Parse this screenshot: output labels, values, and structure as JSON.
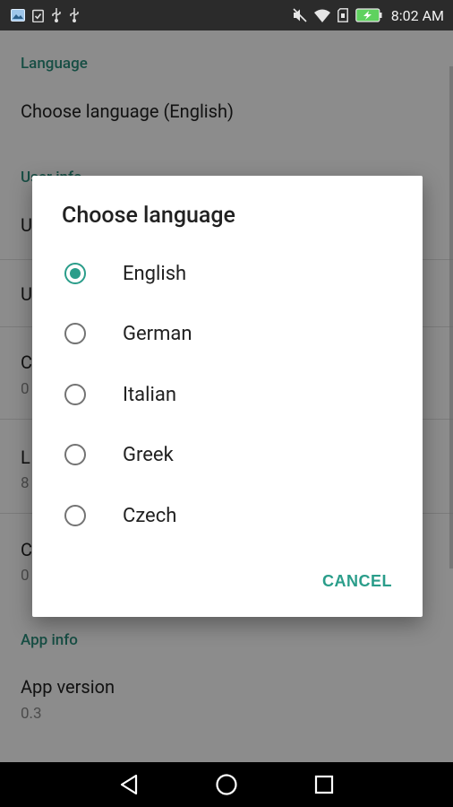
{
  "status_bar": {
    "time": "8:02 AM",
    "left_icons": [
      "image-icon",
      "clipboard-check-icon",
      "usb-icon",
      "usb-icon"
    ],
    "right_icons": [
      "mute-icon",
      "wifi-icon",
      "sim-icon",
      "battery-charging-icon"
    ]
  },
  "settings": {
    "language_header": "Language",
    "choose_language_title": "Choose language (English)",
    "user_info_header": "User info",
    "rows": [
      {
        "title": "U",
        "summary": ""
      },
      {
        "title": "U",
        "summary": ""
      },
      {
        "title": "C",
        "summary": "0"
      },
      {
        "title": "L",
        "summary": "8"
      },
      {
        "title": "C",
        "summary": "0"
      }
    ],
    "app_info_header": "App info",
    "app_version_title": "App version",
    "app_version_value": "0.3"
  },
  "dialog": {
    "title": "Choose language",
    "options": [
      {
        "label": "English",
        "checked": true
      },
      {
        "label": "German",
        "checked": false
      },
      {
        "label": "Italian",
        "checked": false
      },
      {
        "label": "Greek",
        "checked": false
      },
      {
        "label": "Czech",
        "checked": false
      }
    ],
    "cancel_label": "CANCEL"
  },
  "nav_bar": {
    "buttons": [
      "back-icon",
      "home-icon",
      "recents-icon"
    ]
  },
  "colors": {
    "accent": "#2a9d8a",
    "status_bar": "#2b2b2b",
    "scrim": "rgba(0,0,0,0.45)"
  }
}
